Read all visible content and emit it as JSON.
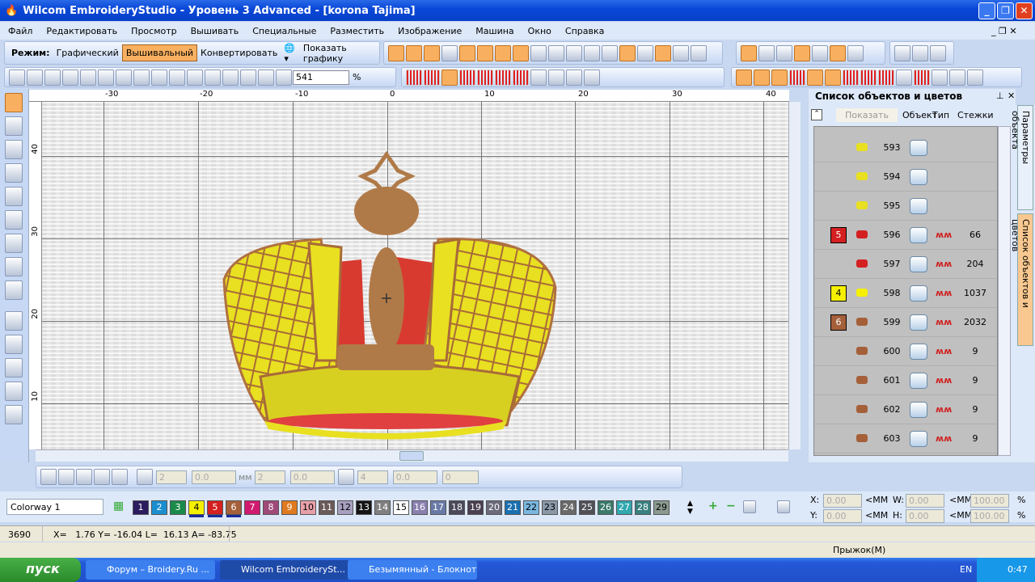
{
  "window": {
    "title": "Wilcom EmbroideryStudio - Уровень 3 Advanced - [korona          Tajima]",
    "min": "_",
    "max": "❐",
    "close": "✕"
  },
  "menu": [
    "Файл",
    "Редактировать",
    "Просмотр",
    "Вышивать",
    "Специальные",
    "Разместить",
    "Изображение",
    "Машина",
    "Окно",
    "Справка"
  ],
  "mode_toolbar": {
    "label": "Режим:",
    "graphic": "Графический",
    "embroidery": "Вышивальный",
    "convert": "Конвертировать",
    "show_graphics": "Показать графику"
  },
  "zoom": {
    "value": "541",
    "unit": "%"
  },
  "ruler": {
    "top": [
      "-30",
      "-20",
      "-10",
      "0",
      "10",
      "20",
      "30",
      "40"
    ],
    "left": [
      "40",
      "30",
      "20",
      "10"
    ]
  },
  "panel": {
    "title": "Список объектов и цветов",
    "show_button": "Показать",
    "columns": [
      "Объект",
      "Тип",
      "Стежки"
    ],
    "rows": [
      {
        "color": "",
        "num": "593",
        "stitches": ""
      },
      {
        "color": "",
        "num": "594",
        "stitches": ""
      },
      {
        "color": "",
        "num": "595",
        "stitches": ""
      },
      {
        "color": "5",
        "swatch": "#d42020",
        "num": "596",
        "stitches": "66"
      },
      {
        "color": "",
        "num": "597",
        "stitches": "204"
      },
      {
        "color": "4",
        "swatch": "#f5f000",
        "num": "598",
        "stitches": "1037"
      },
      {
        "color": "6",
        "swatch": "#a5603a",
        "num": "599",
        "stitches": "2032"
      },
      {
        "color": "",
        "num": "600",
        "stitches": "9"
      },
      {
        "color": "",
        "num": "601",
        "stitches": "9"
      },
      {
        "color": "",
        "num": "602",
        "stitches": "9"
      },
      {
        "color": "",
        "num": "603",
        "stitches": "9"
      }
    ],
    "side_tabs": [
      "Параметры объекта",
      "Список объектов и цветов"
    ]
  },
  "bottom_toolbar": {
    "v1": "2",
    "v2": "0.0",
    "v3": "2",
    "v4": "0.0",
    "v5": "4",
    "v6": "0.0",
    "v7": "0",
    "mm": "мм"
  },
  "palette": {
    "colorway": "Colorway 1",
    "colors": [
      {
        "n": "1",
        "c": "#2a1a5e"
      },
      {
        "n": "2",
        "c": "#1a8fd0"
      },
      {
        "n": "3",
        "c": "#1a8a4a"
      },
      {
        "n": "4",
        "c": "#f5f000"
      },
      {
        "n": "5",
        "c": "#d42020"
      },
      {
        "n": "6",
        "c": "#a5603a"
      },
      {
        "n": "7",
        "c": "#d01a70"
      },
      {
        "n": "8",
        "c": "#a04a7a"
      },
      {
        "n": "9",
        "c": "#e07a20"
      },
      {
        "n": "10",
        "c": "#e8a0a8"
      },
      {
        "n": "11",
        "c": "#6a5a58"
      },
      {
        "n": "12",
        "c": "#a8a0c0"
      },
      {
        "n": "13",
        "c": "#151515"
      },
      {
        "n": "14",
        "c": "#808080"
      },
      {
        "n": "15",
        "c": "#ffffff"
      },
      {
        "n": "16",
        "c": "#8a80b0"
      },
      {
        "n": "17",
        "c": "#6a7aa8"
      },
      {
        "n": "18",
        "c": "#4a4a5a"
      },
      {
        "n": "19",
        "c": "#4a4050"
      },
      {
        "n": "20",
        "c": "#6a6a7a"
      },
      {
        "n": "21",
        "c": "#1a70b0"
      },
      {
        "n": "22",
        "c": "#7ab8e0"
      },
      {
        "n": "23",
        "c": "#8a98a8"
      },
      {
        "n": "24",
        "c": "#6a6a6a"
      },
      {
        "n": "25",
        "c": "#505058"
      },
      {
        "n": "26",
        "c": "#3a7a6a"
      },
      {
        "n": "27",
        "c": "#30a8b0"
      },
      {
        "n": "28",
        "c": "#3a8080"
      },
      {
        "n": "29",
        "c": "#8a9a90"
      }
    ]
  },
  "coords": {
    "x_label": "X:",
    "y_label": "Y:",
    "w_label": "W:",
    "h_label": "H:",
    "x": "0.00",
    "y": "0.00",
    "w": "0.00",
    "h": "0.00",
    "unit": "<MM",
    "sx": "100.00",
    "sy": "100.00",
    "pct": "%"
  },
  "status": {
    "stitch_count": "3690",
    "coords": "X=   1.76 Y= -16.04 L=  16.13 A= -83.75",
    "jump": "Прыжок(M)"
  },
  "taskbar": {
    "start": "пуск",
    "tasks": [
      "Форум – Broidery.Ru ...",
      "Wilcom EmbroiderySt...",
      "Безымянный - Блокнот"
    ],
    "lang": "EN",
    "time": "0:47"
  }
}
